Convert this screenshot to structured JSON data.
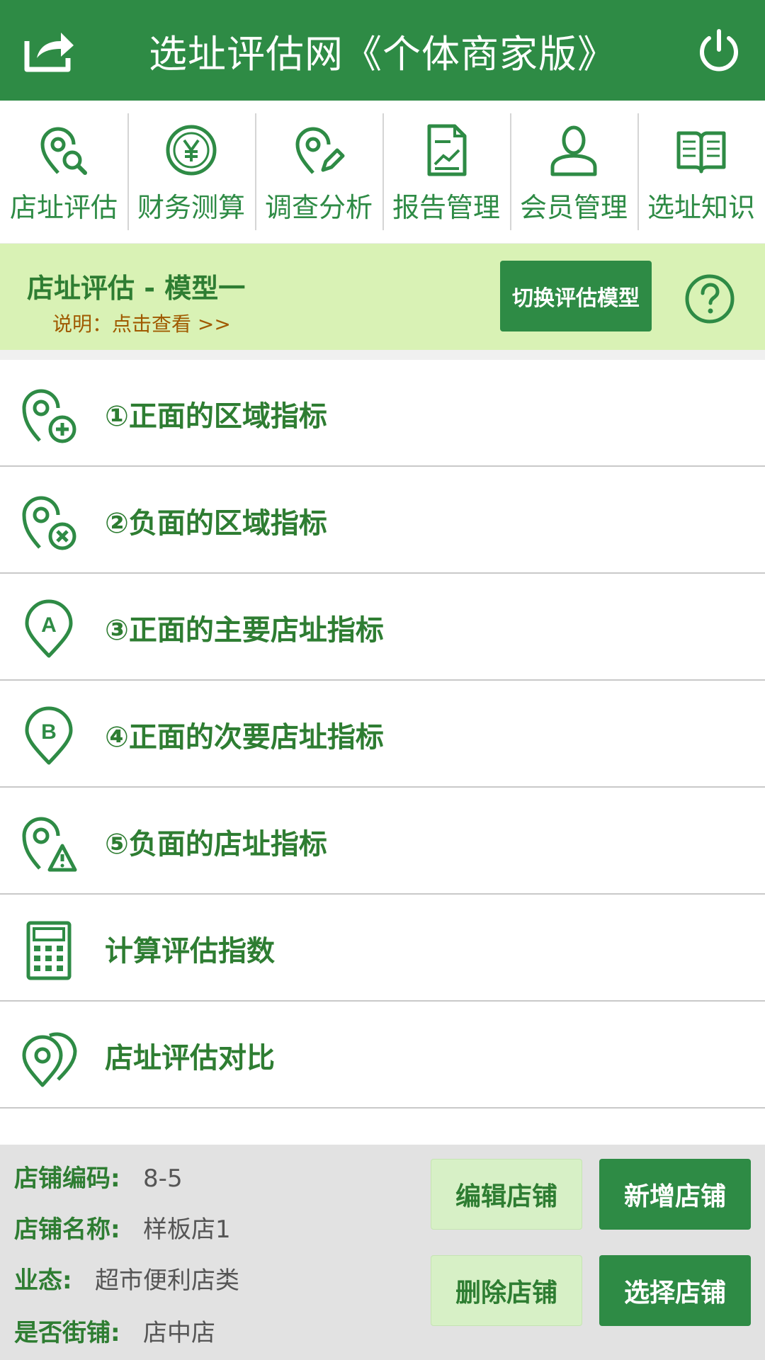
{
  "header": {
    "title": "选址评估网《个体商家版》",
    "share_icon": "share-icon",
    "power_icon": "power-icon",
    "color": "#2e8b45"
  },
  "nav": {
    "items": [
      {
        "label": "店址评估",
        "icon": "location-search-icon"
      },
      {
        "label": "财务测算",
        "icon": "yen-coin-icon"
      },
      {
        "label": "调查分析",
        "icon": "location-edit-icon"
      },
      {
        "label": "报告管理",
        "icon": "report-chart-icon"
      },
      {
        "label": "会员管理",
        "icon": "user-icon"
      },
      {
        "label": "选址知识",
        "icon": "book-icon"
      }
    ]
  },
  "model": {
    "title": "店址评估 - 模型一",
    "desc_prefix": "说明：",
    "desc_link": "点击查看 >>",
    "switch_label": "切换评估模型",
    "help_icon": "help-icon",
    "bg_color": "#d9f2b5"
  },
  "menu": {
    "items": [
      {
        "label": "①正面的区域指标",
        "icon": "location-plus-icon"
      },
      {
        "label": "②负面的区域指标",
        "icon": "location-x-icon"
      },
      {
        "label": "③正面的主要店址指标",
        "icon": "location-a-icon"
      },
      {
        "label": "④正面的次要店址指标",
        "icon": "location-b-icon"
      },
      {
        "label": "⑤负面的店址指标",
        "icon": "location-warning-icon"
      },
      {
        "label": "计算评估指数",
        "icon": "calculator-icon"
      },
      {
        "label": "店址评估对比",
        "icon": "location-compare-icon"
      }
    ]
  },
  "store": {
    "code_label": "店铺编码:",
    "code_value": "8-5",
    "name_label": "店铺名称:",
    "name_value": "样板店1",
    "type_label": "业态:",
    "type_value": "超市便利店类",
    "street_label": "是否街铺:",
    "street_value": "店中店"
  },
  "buttons": {
    "edit": "编辑店铺",
    "add": "新增店铺",
    "delete": "删除店铺",
    "select": "选择店铺"
  }
}
